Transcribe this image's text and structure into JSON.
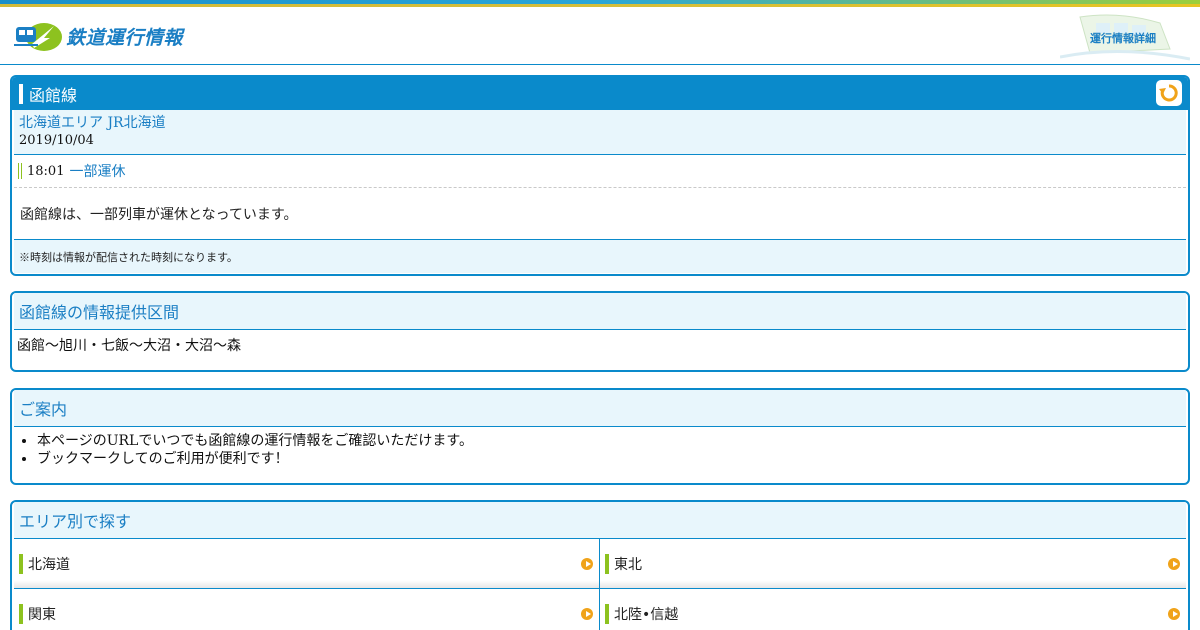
{
  "header": {
    "logo_text": "鉄道運行情報",
    "detail_link": "運行情報詳細"
  },
  "status": {
    "line_name": "函館線",
    "area": "北海道エリア JR北海道",
    "date": "2019/10/04",
    "time": "18:01",
    "state": "一部運休",
    "message": "函館線は、一部列車が運休となっています。",
    "note": "※時刻は情報が配信された時刻になります。"
  },
  "section_range": {
    "title": "函館線の情報提供区間",
    "body": "函館～旭川・七飯～大沼・大沼～森"
  },
  "section_guide": {
    "title": "ご案内",
    "items": [
      "本ページのURLでいつでも函館線の運行情報をご確認いただけます。",
      "ブックマークしてのご利用が便利です！"
    ]
  },
  "section_area": {
    "title": "エリア別で探す",
    "areas": [
      "北海道",
      "東北",
      "関東",
      "北陸•信越"
    ]
  },
  "colors": {
    "brand_blue": "#0a8acb",
    "accent_green": "#8dc21f",
    "arrow_orange": "#f0a31a",
    "light_bg": "#e8f6fc"
  }
}
